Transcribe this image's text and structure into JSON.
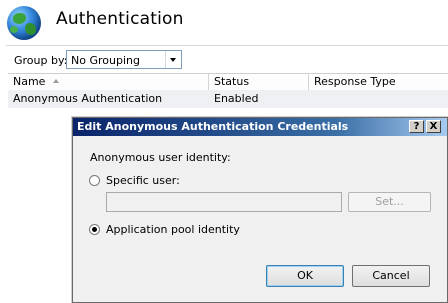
{
  "page": {
    "title": "Authentication",
    "group_by_label": "Group by:",
    "group_by_value": "No Grouping"
  },
  "list": {
    "columns": [
      "Name",
      "Status",
      "Response Type"
    ],
    "rows": [
      {
        "name": "Anonymous Authentication",
        "status": "Enabled",
        "response_type": ""
      }
    ]
  },
  "dialog": {
    "title": "Edit Anonymous Authentication Credentials",
    "help_glyph": "?",
    "close_glyph": "X",
    "identity_label": "Anonymous user identity:",
    "specific_user_label": "Specific user:",
    "specific_user_value": "",
    "specific_user_selected": false,
    "set_button": "Set...",
    "app_pool_label": "Application pool identity",
    "app_pool_selected": true,
    "ok_button": "OK",
    "cancel_button": "Cancel"
  },
  "colors": {
    "title_bar_start": "#0a246a",
    "title_bar_end": "#a6caf0",
    "selected_row": "#eef0f3"
  }
}
